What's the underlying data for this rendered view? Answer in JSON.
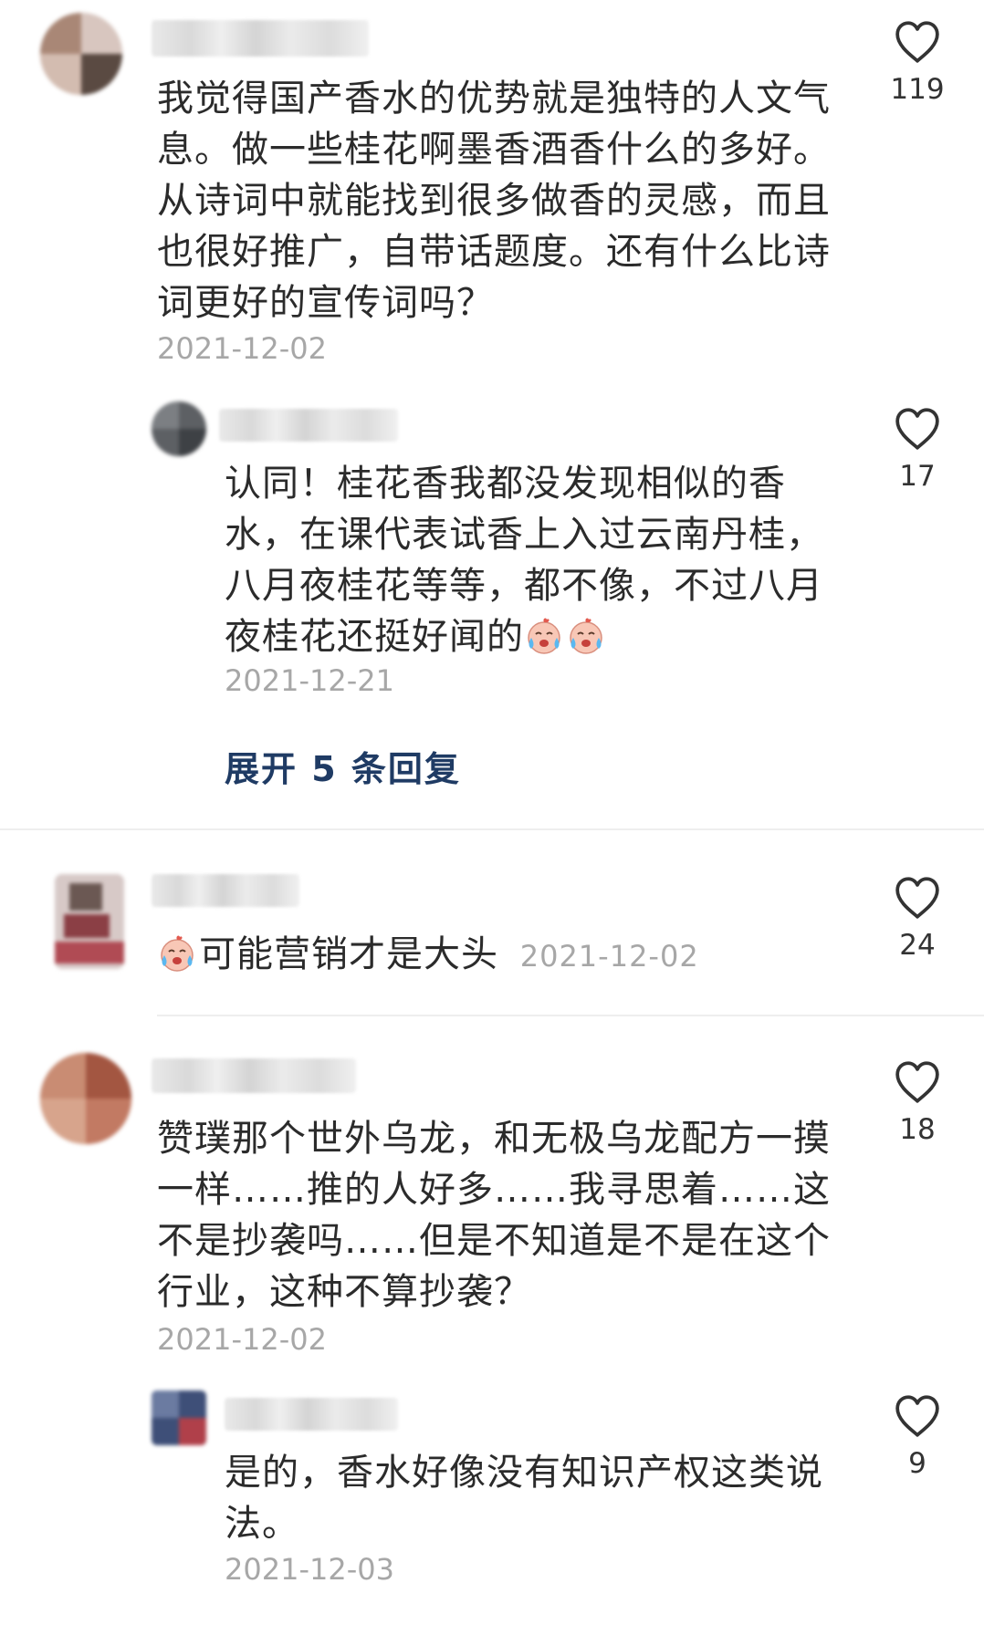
{
  "comments": [
    {
      "text": "我觉得国产香水的优势就是独特的人文气息。做一些桂花啊墨香酒香什么的多好。从诗词中就能找到很多做香的灵感，而且也很好推广，自带话题度。还有什么比诗词更好的宣传词吗？",
      "date": "2021-12-02",
      "likes": "119",
      "reply": {
        "text": "认同！桂花香我都没发现相似的香水，在课代表试香上入过云南丹桂，八月夜桂花等等，都不像，不过八月夜桂花还挺好闻的",
        "date": "2021-12-21",
        "likes": "17",
        "emoji": [
          "crying-emoji",
          "crying-emoji"
        ]
      },
      "expand_label": "展开 5 条回复"
    },
    {
      "text": "可能营销才是大头",
      "date": "2021-12-02",
      "likes": "24",
      "emoji": "crying-emoji"
    },
    {
      "text": "赞璞那个世外乌龙，和无极乌龙配方一摸一样……推的人好多……我寻思着……这不是抄袭吗……但是不知道是不是在这个行业，这种不算抄袭？",
      "date": "2021-12-02",
      "likes": "18",
      "reply": {
        "text": "是的，香水好像没有知识产权这类说法。",
        "date": "2021-12-03",
        "likes": "9"
      }
    }
  ],
  "icons": {
    "like": "heart-outline-icon",
    "emoji": "crying-emoji"
  },
  "colors": {
    "text": "#2b2b2b",
    "date": "#a7a7a7",
    "expand": "#1f3b64",
    "icon": "#333333"
  }
}
